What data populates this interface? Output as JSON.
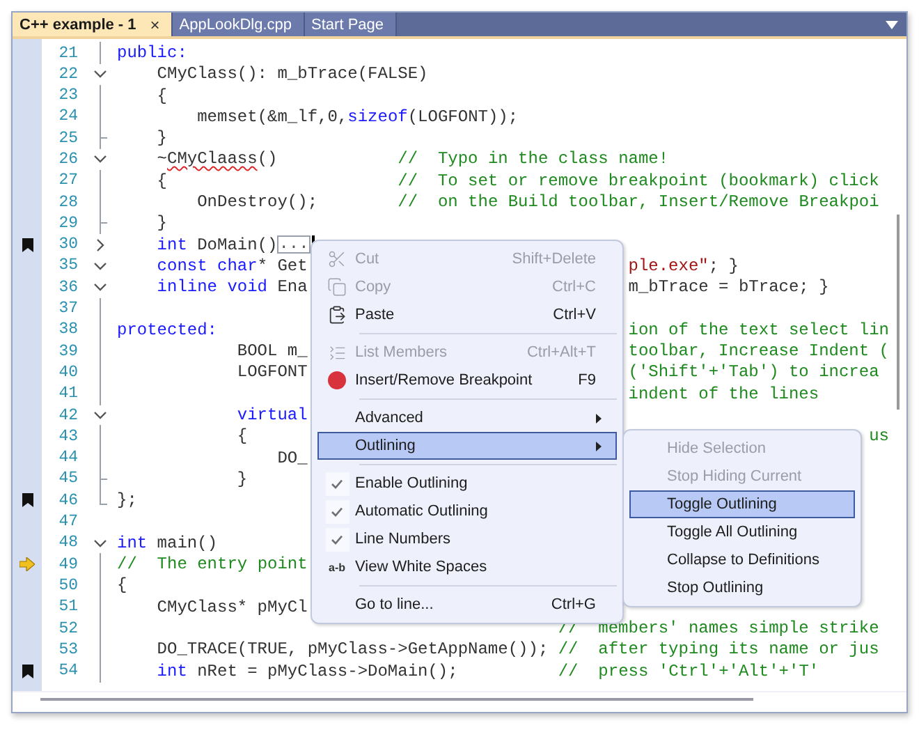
{
  "tabs": [
    {
      "label": "C++ example - 1",
      "selected": true,
      "close": "×"
    },
    {
      "label": "AppLookDlg.cpp",
      "selected": false
    },
    {
      "label": "Start Page",
      "selected": false
    }
  ],
  "rows": [
    {
      "n": "21",
      "fold": {
        "kind": "line"
      },
      "parts": [
        {
          "t": "public:",
          "kind": "keyword"
        }
      ]
    },
    {
      "n": "22",
      "fold": {
        "kind": "open"
      },
      "parts": [
        {
          "t": "    CMyClass(): m_bTrace(FALSE)",
          "kind": "plain"
        }
      ]
    },
    {
      "n": "23",
      "fold": {
        "kind": "line"
      },
      "parts": [
        {
          "t": "    {",
          "kind": "plain"
        }
      ]
    },
    {
      "n": "24",
      "fold": {
        "kind": "line"
      },
      "parts": [
        {
          "t": "        memset(&m_lf,0,",
          "kind": "plain"
        },
        {
          "t": "sizeof",
          "kind": "keyword"
        },
        {
          "t": "(LOGFONT));",
          "kind": "plain"
        }
      ]
    },
    {
      "n": "25",
      "fold": {
        "kind": "tee"
      },
      "parts": [
        {
          "t": "    }",
          "kind": "plain"
        }
      ]
    },
    {
      "n": "26",
      "fold": {
        "kind": "open"
      },
      "parts": [
        {
          "t": "    ~",
          "kind": "plain"
        },
        {
          "t": "CMyClaass",
          "kind": "error"
        },
        {
          "t": "()            ",
          "kind": "plain"
        },
        {
          "t": "//  Typo in the class name!",
          "kind": "comment"
        }
      ]
    },
    {
      "n": "27",
      "fold": {
        "kind": "line"
      },
      "parts": [
        {
          "t": "    {                       ",
          "kind": "plain"
        },
        {
          "t": "//  To set or remove breakpoint (bookmark) click",
          "kind": "comment"
        }
      ]
    },
    {
      "n": "28",
      "fold": {
        "kind": "line"
      },
      "parts": [
        {
          "t": "        OnDestroy();        ",
          "kind": "plain"
        },
        {
          "t": "//  on the Build toolbar, Insert/Remove Breakpoi",
          "kind": "comment"
        }
      ]
    },
    {
      "n": "29",
      "fold": {
        "kind": "tee"
      },
      "parts": [
        {
          "t": "    }",
          "kind": "plain"
        }
      ]
    },
    {
      "n": "30",
      "fold": {
        "kind": "collapsed"
      },
      "marker": {
        "kind": "bookmark"
      },
      "caret": true,
      "parts": [
        {
          "t": "    int",
          "kind": "keyword"
        },
        {
          "t": " DoMain()",
          "kind": "plain"
        },
        {
          "t": "...",
          "kind": "collapsed"
        }
      ]
    },
    {
      "n": "35",
      "fold": {
        "kind": "open"
      },
      "parts": [
        {
          "t": "    const char",
          "kind": "keyword"
        },
        {
          "t": "* Get",
          "kind": "plain"
        }
      ],
      "tail": [
        {
          "t": "ple.exe\"",
          "kind": "string"
        },
        {
          "t": "; }",
          "kind": "plain"
        }
      ]
    },
    {
      "n": "36",
      "fold": {
        "kind": "open"
      },
      "parts": [
        {
          "t": "    inline void",
          "kind": "keyword"
        },
        {
          "t": " Ena",
          "kind": "plain"
        }
      ],
      "tail": [
        {
          "t": "m_bTrace = bTrace; }",
          "kind": "plain"
        }
      ]
    },
    {
      "n": "37",
      "fold": {
        "kind": "line"
      }
    },
    {
      "n": "38",
      "fold": {
        "kind": "line"
      },
      "parts": [
        {
          "t": "protected:",
          "kind": "keyword"
        }
      ],
      "tail": [
        {
          "t": "ion of the text select lin",
          "kind": "comment"
        }
      ]
    },
    {
      "n": "39",
      "fold": {
        "kind": "line"
      },
      "parts": [
        {
          "t": "            BOOL m_",
          "kind": "plain"
        }
      ],
      "tail": [
        {
          "t": "toolbar, Increase Indent (",
          "kind": "comment"
        }
      ]
    },
    {
      "n": "40",
      "fold": {
        "kind": "line"
      },
      "parts": [
        {
          "t": "            LOGFONT",
          "kind": "plain"
        }
      ],
      "tail": [
        {
          "t": "('Shift'+'Tab') to increa",
          "kind": "comment"
        }
      ]
    },
    {
      "n": "41",
      "fold": {
        "kind": "line"
      },
      "tail": [
        {
          "t": "indent of the lines",
          "kind": "comment"
        }
      ]
    },
    {
      "n": "42",
      "fold": {
        "kind": "open"
      },
      "parts": [
        {
          "t": "            virtual",
          "kind": "keyword"
        }
      ]
    },
    {
      "n": "43",
      "fold": {
        "kind": "line"
      },
      "parts": [
        {
          "t": "            {",
          "kind": "plain"
        }
      ],
      "far": [
        {
          "t": "us",
          "kind": "comment"
        }
      ]
    },
    {
      "n": "44",
      "fold": {
        "kind": "line"
      },
      "parts": [
        {
          "t": "                DO_",
          "kind": "plain"
        }
      ]
    },
    {
      "n": "45",
      "fold": {
        "kind": "tee"
      },
      "parts": [
        {
          "t": "            }",
          "kind": "plain"
        }
      ]
    },
    {
      "n": "46",
      "fold": {
        "kind": "end"
      },
      "marker": {
        "kind": "bookmark"
      },
      "parts": [
        {
          "t": "};",
          "kind": "plain"
        }
      ]
    },
    {
      "n": "47"
    },
    {
      "n": "48",
      "fold": {
        "kind": "open"
      },
      "parts": [
        {
          "t": "int",
          "kind": "keyword"
        },
        {
          "t": " main()",
          "kind": "plain"
        }
      ]
    },
    {
      "n": "49",
      "fold": {
        "kind": "line"
      },
      "marker": {
        "kind": "arrow"
      },
      "parts": [
        {
          "t": "//  The entry point",
          "kind": "comment"
        }
      ]
    },
    {
      "n": "50",
      "fold": {
        "kind": "line"
      },
      "parts": [
        {
          "t": "{",
          "kind": "plain"
        }
      ]
    },
    {
      "n": "51",
      "fold": {
        "kind": "line"
      },
      "parts": [
        {
          "t": "    CMyClass* pMyCl",
          "kind": "plain"
        }
      ]
    },
    {
      "n": "52",
      "fold": {
        "kind": "line"
      },
      "parts": [
        {
          "t": "                                            //  members' names simple strike",
          "kind": "comment"
        }
      ]
    },
    {
      "n": "53",
      "fold": {
        "kind": "line"
      },
      "parts": [
        {
          "t": "    DO_TRACE(TRUE, pMyClass->GetAppName()); ",
          "kind": "plain"
        },
        {
          "t": "//  after typing its name or jus",
          "kind": "comment"
        }
      ]
    },
    {
      "n": "54",
      "fold": {
        "kind": "line"
      },
      "marker": {
        "kind": "bookmark"
      },
      "parts": [
        {
          "t": "    int",
          "kind": "keyword"
        },
        {
          "t": " nRet = pMyClass->DoMain();          ",
          "kind": "plain"
        },
        {
          "t": "//  press 'Ctrl'+'Alt'+'T'",
          "kind": "comment"
        }
      ]
    }
  ],
  "context_menu": {
    "items": [
      {
        "kind": "item",
        "label": "Cut",
        "shortcut": "Shift+Delete",
        "disabled": true,
        "selected": false
      },
      {
        "kind": "item",
        "label": "Copy",
        "shortcut": "Ctrl+C",
        "disabled": true,
        "selected": false
      },
      {
        "kind": "item",
        "label": "Paste",
        "shortcut": "Ctrl+V",
        "disabled": false,
        "selected": false
      },
      {
        "kind": "separator"
      },
      {
        "kind": "item",
        "label": "List Members",
        "shortcut": "Ctrl+Alt+T",
        "disabled": true,
        "selected": false
      },
      {
        "kind": "item",
        "label": "Insert/Remove Breakpoint",
        "shortcut": "F9",
        "disabled": false,
        "selected": false
      },
      {
        "kind": "separator"
      },
      {
        "kind": "submenu",
        "label": "Advanced",
        "selected": false
      },
      {
        "kind": "submenu",
        "label": "Outlining",
        "selected": true
      },
      {
        "kind": "separator"
      },
      {
        "kind": "check",
        "label": "Enable Outlining",
        "checked": true,
        "selected": false
      },
      {
        "kind": "check",
        "label": "Automatic Outlining",
        "checked": true,
        "selected": false
      },
      {
        "kind": "check",
        "label": "Line Numbers",
        "checked": true,
        "selected": false
      },
      {
        "kind": "check",
        "label": "View White Spaces",
        "checked": false,
        "icon_text": "a-b",
        "selected": false
      },
      {
        "kind": "separator"
      },
      {
        "kind": "item",
        "label": "Go to line...",
        "shortcut": "Ctrl+G",
        "disabled": false,
        "selected": false
      }
    ]
  },
  "submenu": {
    "items": [
      {
        "label": "Hide Selection",
        "disabled": true,
        "selected": false
      },
      {
        "label": "Stop Hiding Current",
        "disabled": true,
        "selected": false
      },
      {
        "label": "Toggle Outlining",
        "disabled": false,
        "selected": true
      },
      {
        "label": "Toggle All Outlining",
        "disabled": false,
        "selected": false
      },
      {
        "label": "Collapse to Definitions",
        "disabled": false,
        "selected": false
      },
      {
        "label": "Stop Outlining",
        "disabled": false,
        "selected": false
      }
    ]
  }
}
